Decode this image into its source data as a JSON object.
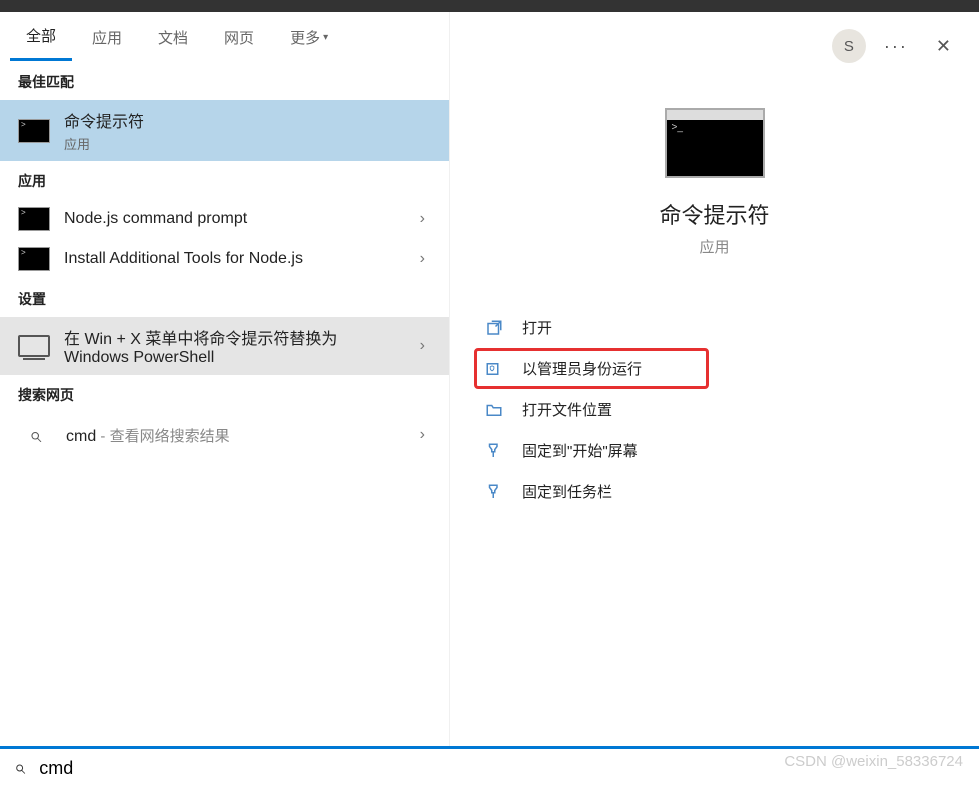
{
  "tabs": [
    "全部",
    "应用",
    "文档",
    "网页",
    "更多"
  ],
  "active_tab_index": 0,
  "sections": {
    "best_match": "最佳匹配",
    "apps": "应用",
    "settings": "设置",
    "web": "搜索网页"
  },
  "best_match_item": {
    "title": "命令提示符",
    "subtitle": "应用"
  },
  "app_items": [
    {
      "title": "Node.js command prompt"
    },
    {
      "title": "Install Additional Tools for Node.js"
    }
  ],
  "settings_items": [
    {
      "title": "在 Win + X 菜单中将命令提示符替换为 Windows PowerShell"
    }
  ],
  "web_items": [
    {
      "title": "cmd",
      "suffix": " - 查看网络搜索结果"
    }
  ],
  "right_header": {
    "avatar_initial": "S"
  },
  "detail": {
    "title": "命令提示符",
    "subtitle": "应用"
  },
  "actions": [
    {
      "label": "打开",
      "icon": "open"
    },
    {
      "label": "以管理员身份运行",
      "icon": "admin",
      "highlighted": true
    },
    {
      "label": "打开文件位置",
      "icon": "folder"
    },
    {
      "label": "固定到\"开始\"屏幕",
      "icon": "pin"
    },
    {
      "label": "固定到任务栏",
      "icon": "pin"
    }
  ],
  "search": {
    "value": "cmd"
  },
  "watermark": "CSDN @weixin_58336724"
}
